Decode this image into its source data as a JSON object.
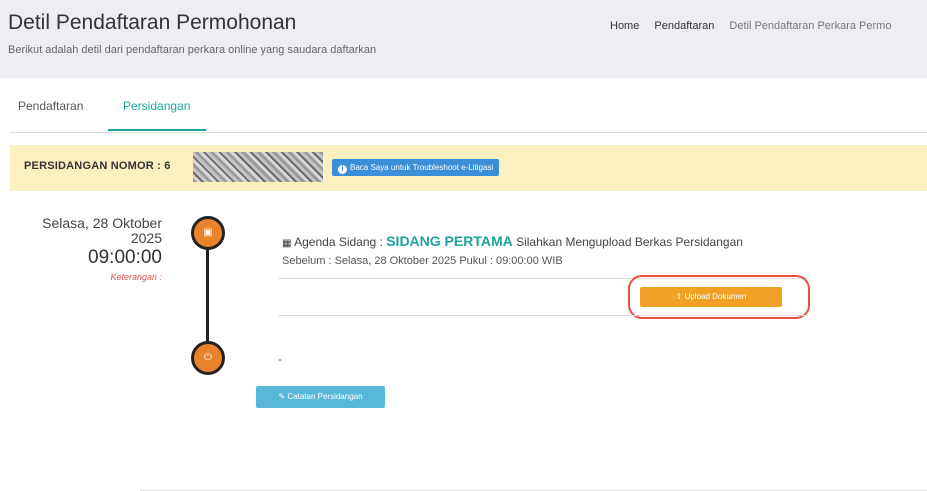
{
  "header": {
    "title": "Detil Pendaftaran Permohonan",
    "subtitle": "Berikut adalah detil dari pendaftaran perkara online yang saudara daftarkan",
    "breadcrumbs": [
      "Home",
      "Pendaftaran",
      "Detil Pendaftaran Perkara Permo"
    ]
  },
  "tabs": [
    {
      "label": "Pendaftaran",
      "active": false
    },
    {
      "label": "Persidangan",
      "active": true
    }
  ],
  "alert": {
    "label": "PERSIDANGAN NOMOR : 6",
    "help_button": "Baca Saya untuk Troubleshoot e-Litigasi"
  },
  "session": {
    "date": "Selasa, 28 Oktober 2025",
    "time": "09:00:00",
    "keterangan": "Keterangan :",
    "agenda_prefix": "Agenda Sidang :",
    "agenda_name": "SIDANG PERTAMA",
    "agenda_suffix": "Silahkan Mengupload Berkas Persidangan",
    "deadline": "Sebelum : Selasa, 28 Oktober 2025 Pukul : 09:00:00 WIB",
    "upload_button": "Upload Dokumen",
    "second_entry": "-",
    "notes_button": "Catatan Persidangan"
  },
  "colors": {
    "accent": "#1aa39a",
    "upload": "#f0a024",
    "timeline_node": "#e8832c",
    "alert_bg": "#fcf0c1",
    "highlight_ring": "#e8533a"
  },
  "icons": [
    "info-icon",
    "calendar-icon",
    "power-icon",
    "upload-icon",
    "edit-icon"
  ]
}
